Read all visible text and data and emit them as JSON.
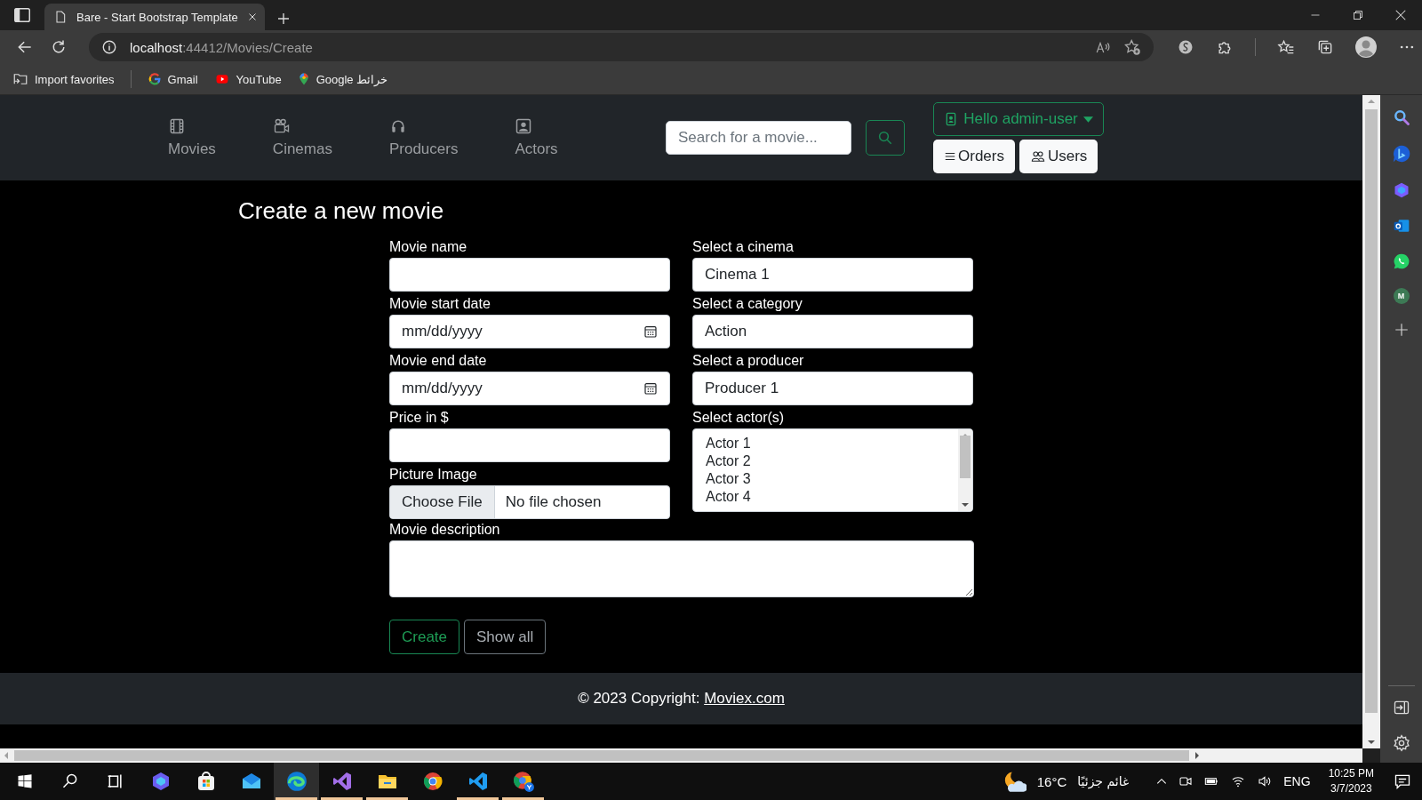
{
  "browser": {
    "tab": {
      "title": "Bare - Start Bootstrap Template"
    },
    "address": {
      "host": "localhost",
      "path": ":44412/Movies/Create"
    },
    "bookmarks": [
      {
        "kind": "import",
        "label": "Import favorites"
      },
      {
        "kind": "google",
        "label": "Gmail"
      },
      {
        "kind": "youtube",
        "label": "YouTube"
      },
      {
        "kind": "maps",
        "label": "Google خرائط"
      }
    ]
  },
  "navbar": {
    "links": [
      {
        "kind": "film",
        "label": "Movies"
      },
      {
        "kind": "camera",
        "label": "Cinemas"
      },
      {
        "kind": "headphones",
        "label": "Producers"
      },
      {
        "kind": "portrait",
        "label": "Actors"
      }
    ],
    "search": {
      "placeholder": "Search for a movie..."
    },
    "user_menu": {
      "label": "Hello admin-user"
    },
    "buttons": [
      {
        "kind": "list",
        "label": "Orders"
      },
      {
        "kind": "people",
        "label": "Users"
      }
    ]
  },
  "form": {
    "title": "Create a new movie",
    "left_fields": [
      {
        "kind": "text",
        "label": "Movie name"
      },
      {
        "kind": "date",
        "label": "Movie start date",
        "value": "mm/dd/yyyy"
      },
      {
        "kind": "date",
        "label": "Movie end date",
        "value": "mm/dd/yyyy"
      },
      {
        "kind": "text",
        "label": "Price in $"
      },
      {
        "kind": "file",
        "label": "Picture Image",
        "button": "Choose File",
        "status": "No file chosen"
      }
    ],
    "right_fields": [
      {
        "kind": "select",
        "label": "Select a cinema",
        "value": "Cinema 1"
      },
      {
        "kind": "select",
        "label": "Select a category",
        "value": "Action"
      },
      {
        "kind": "select",
        "label": "Select a producer",
        "value": "Producer 1"
      },
      {
        "kind": "listbox",
        "label": "Select actor(s)",
        "options": [
          "Actor 1",
          "Actor 2",
          "Actor 3",
          "Actor 4"
        ]
      }
    ],
    "description": {
      "label": "Movie description"
    },
    "actions": [
      {
        "kind": "success",
        "label": "Create"
      },
      {
        "kind": "secondary",
        "label": "Show all"
      }
    ]
  },
  "footer": {
    "text": "© 2023 Copyright:",
    "link": "Moviex.com"
  },
  "edge_sidebar": [
    {
      "kind": "search"
    },
    {
      "kind": "bing"
    },
    {
      "kind": "copilot"
    },
    {
      "kind": "outlook"
    },
    {
      "kind": "whatsapp"
    },
    {
      "kind": "profile",
      "letter": "M"
    },
    {
      "kind": "add"
    }
  ],
  "taskbar": {
    "system_buttons": [
      {
        "kind": "start"
      },
      {
        "kind": "search"
      },
      {
        "kind": "taskview"
      }
    ],
    "apps": [
      {
        "kind": "copilot",
        "running": false,
        "selected": false
      },
      {
        "kind": "store",
        "running": false,
        "selected": false
      },
      {
        "kind": "mail",
        "running": false,
        "selected": false
      },
      {
        "kind": "edge",
        "running": true,
        "selected": true
      },
      {
        "kind": "vs",
        "running": true,
        "selected": false
      },
      {
        "kind": "explorer",
        "running": true,
        "selected": false
      },
      {
        "kind": "chrome",
        "running": false,
        "selected": false
      },
      {
        "kind": "vscode",
        "running": true,
        "selected": false
      },
      {
        "kind": "chrome_profile",
        "running": true,
        "selected": false
      }
    ],
    "weather": {
      "temperature": "16°C",
      "condition": "غائم جزئيًا"
    },
    "language": "ENG",
    "time": "10:25 PM",
    "date": "3/7/2023"
  }
}
